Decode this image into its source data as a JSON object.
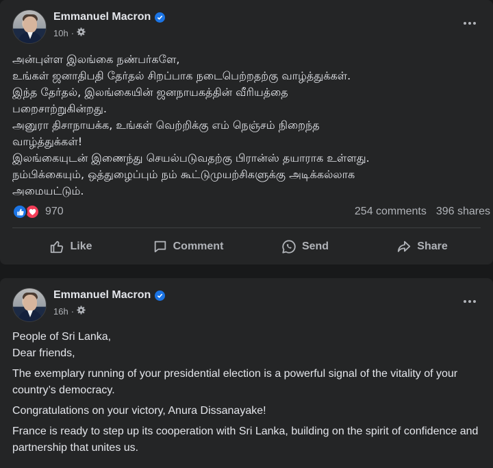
{
  "posts": [
    {
      "author": "Emmanuel Macron",
      "time": "10h",
      "body_lines": [
        "அன்புள்ள இலங்கை நண்பர்களே,",
        "உங்கள் ஜனாதிபதி தேர்தல் சிறப்பாக நடைபெற்றதற்கு வாழ்த்துக்கள்.",
        "இந்த தேர்தல், இலங்கையின் ஜனநாயகத்தின் வீரியத்தை",
        "பறைசாற்றுகின்றது.",
        "அனுரா திசாநாயக்க, உங்கள் வெற்றிக்கு எம் நெஞ்சம் நிறைந்த",
        "வாழ்த்துக்கள்!",
        "இலங்கையுடன் இணைந்து செயல்படுவதற்கு பிரான்ஸ் தயாராக உள்ளது.",
        "நம்பிக்கையும், ஒத்துழைப்பும் நம் கூட்டுமுயற்சிகளுக்கு அடிக்கல்லாக",
        "அமையட்டும்."
      ],
      "reaction_count": "970",
      "comments": "254 comments",
      "shares": "396 shares"
    },
    {
      "author": "Emmanuel Macron",
      "time": "16h",
      "greeting_lines": [
        "People of Sri Lanka,",
        "Dear friends,"
      ],
      "paragraphs": [
        "The exemplary running of your presidential election is a powerful signal of the vitality of your country’s democracy.",
        "Congratulations on your victory, Anura Dissanayake!",
        "France is ready to step up its cooperation with Sri Lanka, building on the spirit of confidence and partnership that unites us."
      ]
    }
  ],
  "actions": {
    "like": "Like",
    "comment": "Comment",
    "send": "Send",
    "share": "Share"
  },
  "colors": {
    "background": "#18191a",
    "card": "#242526",
    "text_primary": "#e4e6eb",
    "text_secondary": "#b0b3b8",
    "verified_blue": "#1b74e4",
    "love_red": "#f33e58"
  },
  "icons": [
    "verified-badge-icon",
    "globe-gear-icon",
    "more-options-icon",
    "like-reaction-icon",
    "love-reaction-icon",
    "thumbs-up-icon",
    "comment-bubble-icon",
    "whatsapp-send-icon",
    "share-arrow-icon"
  ]
}
